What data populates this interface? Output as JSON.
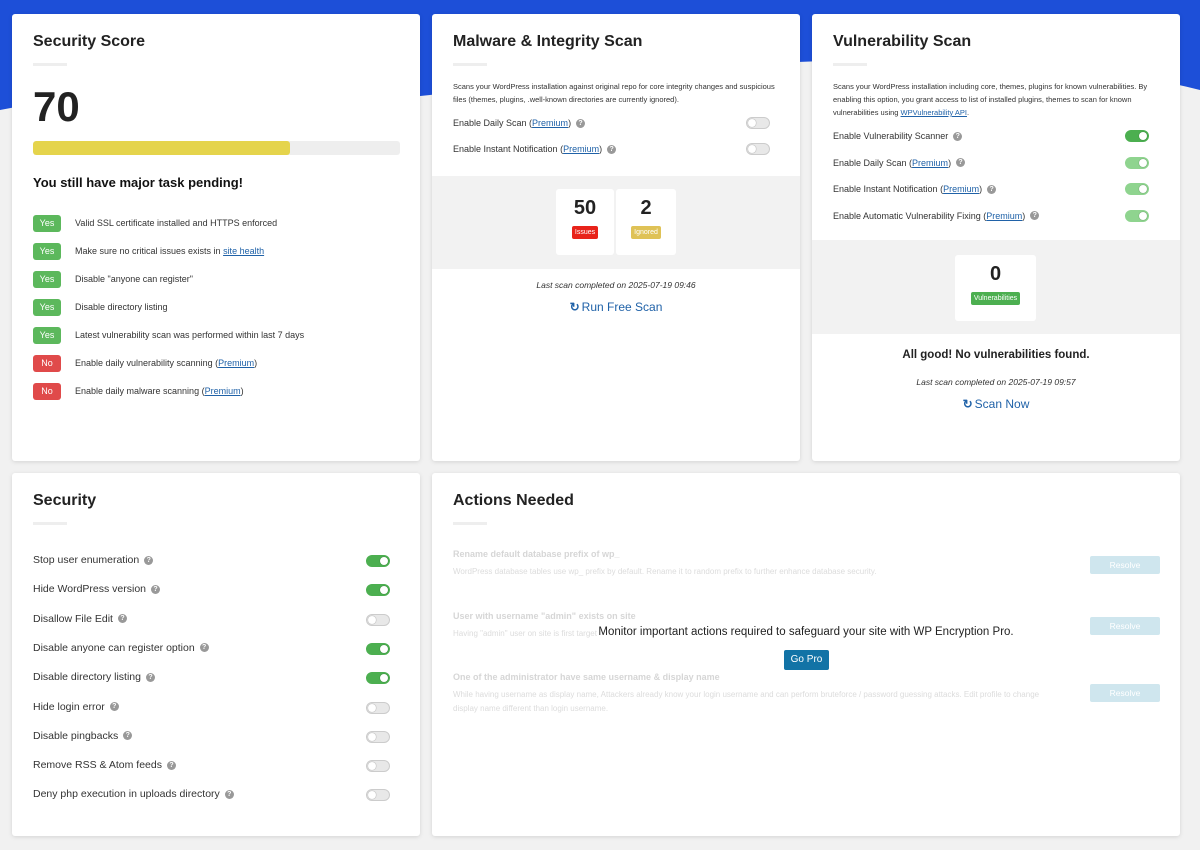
{
  "colors": {
    "accent_blue": "#1d4fd8",
    "green": "#5cb85c",
    "red": "#e04a4a",
    "yellow": "#e5d44c",
    "link": "#2062a8",
    "go_pro": "#1273a6"
  },
  "score_card": {
    "title": "Security Score",
    "score": "70",
    "progress_fraction": 0.7,
    "message": "You still have major task pending!",
    "tasks": [
      {
        "status": "Yes",
        "text": "Valid SSL certificate installed and HTTPS enforced"
      },
      {
        "status": "Yes",
        "text": "Make sure no critical issues exists in ",
        "link": "site health"
      },
      {
        "status": "Yes",
        "text": "Disable \"anyone can register\""
      },
      {
        "status": "Yes",
        "text": "Disable directory listing"
      },
      {
        "status": "Yes",
        "text": "Latest vulnerability scan was performed within last 7 days"
      },
      {
        "status": "No",
        "text": "Enable daily vulnerability scanning (",
        "link": "Premium",
        "suffix": ")"
      },
      {
        "status": "No",
        "text": "Enable daily malware scanning (",
        "link": "Premium",
        "suffix": ")"
      }
    ]
  },
  "malware_card": {
    "title": "Malware & Integrity Scan",
    "description": "Scans your WordPress installation against original repo for core integrity changes and suspicious files (themes, plugins, .well-known directories are currently ignored).",
    "options": [
      {
        "label": "Enable Daily Scan (",
        "link": "Premium",
        "suffix": ")",
        "on": false
      },
      {
        "label": "Enable Instant Notification (",
        "link": "Premium",
        "suffix": ")",
        "on": false
      }
    ],
    "issues_count": "50",
    "issues_label": "Issues",
    "ignored_count": "2",
    "ignored_label": "Ignored",
    "last_scan": "Last scan completed on 2025-07-19 09:46",
    "scan_button": "Run Free Scan"
  },
  "vuln_card": {
    "title": "Vulnerability Scan",
    "description_pre": "Scans your WordPress installation including core, themes, plugins for known vulnerabilities. By enabling this option, you grant access to list of installed plugins, themes to scan for known vulnerabilities using ",
    "description_link": "WPVulnerability API",
    "description_post": ".",
    "options": [
      {
        "label": "Enable Vulnerability Scanner",
        "on": true
      },
      {
        "label": "Enable Daily Scan (",
        "link": "Premium",
        "suffix": ")",
        "on": true
      },
      {
        "label": "Enable Instant Notification (",
        "link": "Premium",
        "suffix": ")",
        "on": true
      },
      {
        "label": "Enable Automatic Vulnerability Fixing (",
        "link": "Premium",
        "suffix": ")",
        "on": true
      }
    ],
    "vuln_count": "0",
    "vuln_label": "Vulnerabilities",
    "good_message": "All good! No vulnerabilities found.",
    "last_scan": "Last scan completed on 2025-07-19 09:57",
    "scan_button": "Scan Now"
  },
  "security_card": {
    "title": "Security",
    "items": [
      {
        "label": "Stop user enumeration",
        "on": true
      },
      {
        "label": "Hide WordPress version",
        "on": true
      },
      {
        "label": "Disallow File Edit",
        "on": false
      },
      {
        "label": "Disable anyone can register option",
        "on": true
      },
      {
        "label": "Disable directory listing",
        "on": true
      },
      {
        "label": "Hide login error",
        "on": false
      },
      {
        "label": "Disable pingbacks",
        "on": false
      },
      {
        "label": "Remove RSS & Atom feeds",
        "on": false
      },
      {
        "label": "Deny php execution in uploads directory",
        "on": false
      }
    ]
  },
  "actions_card": {
    "title": "Actions Needed",
    "actions": [
      {
        "title": "Rename default database prefix of wp_",
        "desc": "WordPress database tables use wp_ prefix by default. Rename it to random prefix to further enhance database security."
      },
      {
        "title": "User with username \"admin\" exists on site",
        "desc": "Having \"admin\" user on site is first target"
      },
      {
        "title": "One of the administrator have same username & display name",
        "desc": "While having username as display name, Attackers already know your login username and can perform bruteforce / password guessing attacks. Edit profile to change display name different than login username."
      }
    ],
    "resolve_label": "Resolve",
    "overlay_message": "Monitor important actions required to safeguard your site with WP Encryption Pro.",
    "go_pro_label": "Go Pro"
  }
}
